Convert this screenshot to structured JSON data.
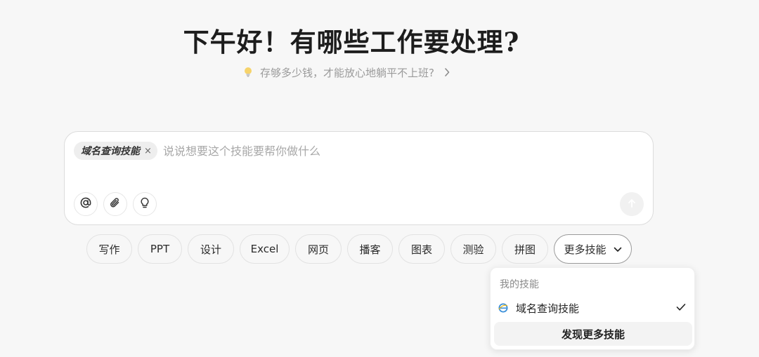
{
  "greeting": "下午好！有哪些工作要处理?",
  "suggestion": {
    "text": "存够多少钱，才能放心地躺平不上班?",
    "icon": "lightbulb-icon"
  },
  "composer": {
    "skill_tag": "域名查询技能",
    "skill_tag_remove": "×",
    "placeholder": "说说想要这个技能要帮你做什么",
    "tools": [
      "at-icon",
      "paperclip-icon",
      "lightbulb-icon"
    ],
    "send_icon": "arrow-up-icon"
  },
  "chips": [
    "写作",
    "PPT",
    "设计",
    "Excel",
    "网页",
    "播客",
    "图表",
    "测验",
    "拼图"
  ],
  "more_skills": "更多技能",
  "dropdown": {
    "heading": "我的技能",
    "item": "域名查询技能",
    "discover": "发现更多技能"
  }
}
